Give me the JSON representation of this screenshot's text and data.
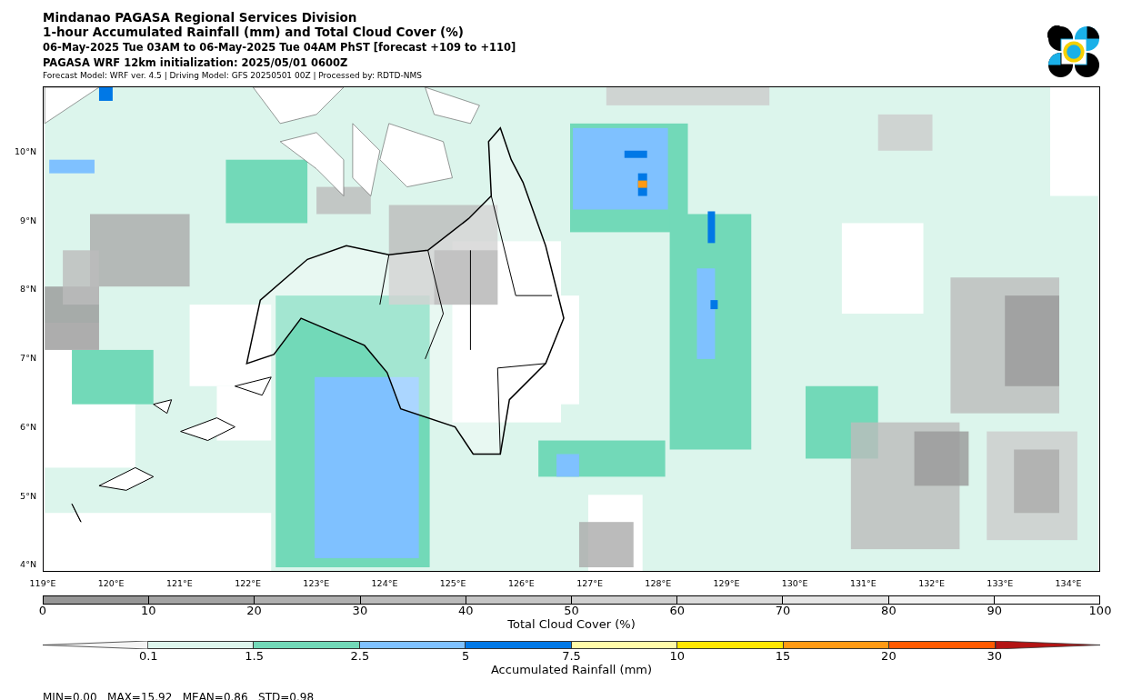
{
  "header": {
    "title": "Mindanao PAGASA Regional Services Division",
    "subtitle": "1-hour Accumulated Rainfall (mm) and Total Cloud Cover (%)",
    "period": "06-May-2025 Tue 03AM to 06-May-2025 Tue 04AM PhST [forecast +109 to +110]",
    "initialization": "PAGASA WRF 12km initialization: 2025/05/01 0600Z",
    "model_info": "Forecast Model: WRF ver. 4.5 | Driving Model: GFS 20250501 00Z | Processed by: RDTD-NMS"
  },
  "map": {
    "lat_labels": [
      "10°N",
      "9°N",
      "8°N",
      "7°N",
      "6°N",
      "5°N",
      "4°N"
    ],
    "lon_labels": [
      "119°E",
      "120°E",
      "121°E",
      "122°E",
      "123°E",
      "124°E",
      "125°E",
      "126°E",
      "127°E",
      "128°E",
      "129°E",
      "130°E",
      "131°E",
      "132°E",
      "133°E",
      "134°E"
    ]
  },
  "cloud_colorbar": {
    "label": "Total Cloud Cover (%)",
    "ticks": [
      "0",
      "10",
      "20",
      "30",
      "40",
      "50",
      "60",
      "70",
      "80",
      "90",
      "100"
    ],
    "segments": [
      {
        "color": "#969696"
      },
      {
        "color": "#a3a3a3"
      },
      {
        "color": "#afafaf"
      },
      {
        "color": "#bababa"
      },
      {
        "color": "#c5c5c5"
      },
      {
        "color": "#d0d0d0"
      },
      {
        "color": "#dbdbdb"
      },
      {
        "color": "#e6e6e6"
      },
      {
        "color": "#f2f2f2"
      },
      {
        "color": "#fbfbfb"
      }
    ]
  },
  "rain_colorbar": {
    "label": "Accumulated Rainfall (mm)",
    "ticks": [
      "0.1",
      "1.5",
      "2.5",
      "5",
      "7.5",
      "10",
      "15",
      "20",
      "30"
    ],
    "segments": [
      {
        "kind": "under",
        "color": "#f4f4f4"
      },
      {
        "kind": "bar",
        "color": "#dcf5ec"
      },
      {
        "kind": "bar",
        "color": "#72d9b8"
      },
      {
        "kind": "bar",
        "color": "#7fc1ff"
      },
      {
        "kind": "bar",
        "color": "#0078e6"
      },
      {
        "kind": "bar",
        "color": "#fffaa8"
      },
      {
        "kind": "bar",
        "color": "#ffe600"
      },
      {
        "kind": "bar",
        "color": "#ff9a14"
      },
      {
        "kind": "bar",
        "color": "#ff5a00"
      },
      {
        "kind": "over",
        "color": "#b41414"
      }
    ]
  },
  "stats": "MIN=0.00   MAX=15.92   MEAN=0.86   STD=0.98"
}
